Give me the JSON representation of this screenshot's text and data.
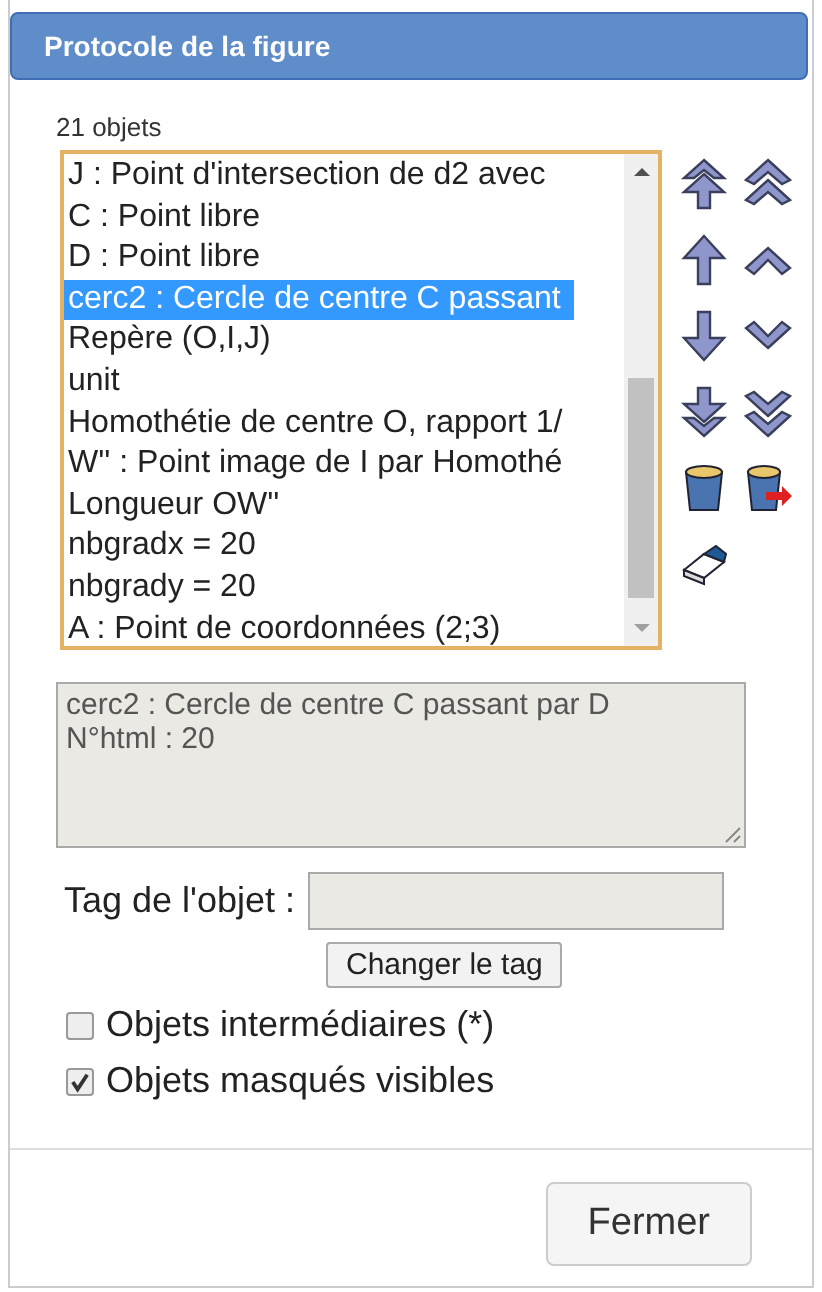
{
  "dialog": {
    "title": "Protocole de la figure"
  },
  "count": "21 objets",
  "objects": [
    {
      "label": "J : Point d'intersection de d2 avec",
      "selected": false
    },
    {
      "label": "C : Point libre",
      "selected": false
    },
    {
      "label": "D : Point libre",
      "selected": false
    },
    {
      "label": "cerc2 : Cercle de centre C passant",
      "selected": true
    },
    {
      "label": "Repère (O,I,J)",
      "selected": false
    },
    {
      "label": "unit",
      "selected": false
    },
    {
      "label": "Homothétie de centre O, rapport 1/",
      "selected": false
    },
    {
      "label": "W'' : Point image de I par Homothé",
      "selected": false
    },
    {
      "label": "Longueur OW''",
      "selected": false
    },
    {
      "label": "nbgradx = 20",
      "selected": false
    },
    {
      "label": "nbgrady = 20",
      "selected": false
    },
    {
      "label": "A : Point de coordonnées (2;3)",
      "selected": false
    }
  ],
  "details": [
    "cerc2 : Cercle de centre C passant par D",
    "N°html : 20"
  ],
  "tag": {
    "label": "Tag de l'objet :",
    "button": "Changer le tag"
  },
  "options": [
    {
      "label": "Objets intermédiaires (*)",
      "checked": false
    },
    {
      "label": "Objets masqués visibles",
      "checked": true
    }
  ],
  "close_button": "Fermer"
}
